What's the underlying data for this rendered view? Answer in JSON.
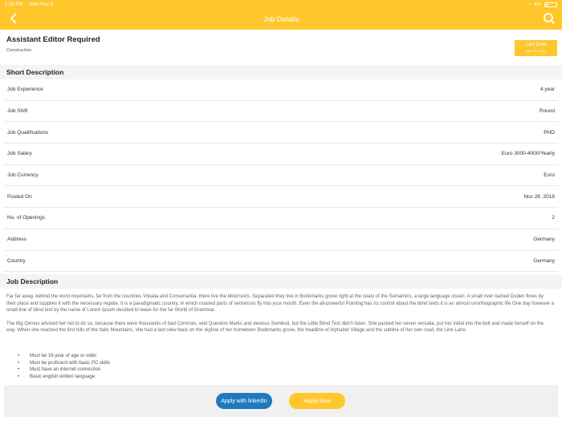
{
  "status_bar": {
    "time": "5:06 PM",
    "date": "Wed Nov 6",
    "battery": "4%"
  },
  "navbar": {
    "title": "Job Details",
    "back_icon": "chevron-left-icon",
    "search_icon": "search-icon"
  },
  "job": {
    "title": "Assistant Editor Required",
    "category": "Construction",
    "last_date_label": "Last Date",
    "last_date_value": "April 11, 2024"
  },
  "short_description": {
    "heading": "Short Description",
    "rows": [
      {
        "label": "Job Experience",
        "value": "4 year"
      },
      {
        "label": "Job Shift",
        "value": "Round"
      },
      {
        "label": "Job Qualifications",
        "value": "PHD"
      },
      {
        "label": "Job Salary",
        "value": "Euro 3000-4000/Yearly"
      },
      {
        "label": "Job Currency",
        "value": "Euro"
      },
      {
        "label": "Posted On",
        "value": "Nov 28 ,2018"
      },
      {
        "label": "No. of Openings",
        "value": "2"
      },
      {
        "label": "Address",
        "value": "Germany"
      },
      {
        "label": "Country",
        "value": "Germany"
      }
    ]
  },
  "job_description": {
    "heading": "Job Description",
    "paragraphs": [
      "Far far away, behind the word mountains, far from the countries Vokalia and Consonantia, there live the blind texts. Separated they live in Bookmarks grove right at the coast of the Semantics, a large language ocean. A small river named Duden flows by their place and supplies it with the necessary regalia. It is a paradigmatic country, in which roasted parts of sentences fly into your mouth. Even the all-powerful Pointing has no control about the blind texts it is an almost unorthographic life One day however a small line of blind text by the name of Lorem Ipsum decided to leave for the far World of Grammar.",
      "The Big Oxmox advised her not to do so, because there were thousands of bad Commas, wild Question Marks and devious Semikoli, but the Little Blind Text didn't listen. She packed her seven versalia, put her initial into the belt and made herself on the way. When she reached the first hills of the Italic Mountains, she had a last view back on the skyline of her hometown Bookmarks grove, the headline of Alphabet Village and the subline of her own road, the Line Lane."
    ],
    "requirements": [
      "Must be 16 year of age or older",
      "Must be proficient with basic PC skills",
      "Must have an internet connection",
      "Basic english written language"
    ]
  },
  "actions": {
    "linkedin_label": "Apply with linkedin",
    "apply_label": "Apply Now"
  },
  "colors": {
    "accent": "#ffc72c",
    "linkedin": "#1f79bf"
  }
}
